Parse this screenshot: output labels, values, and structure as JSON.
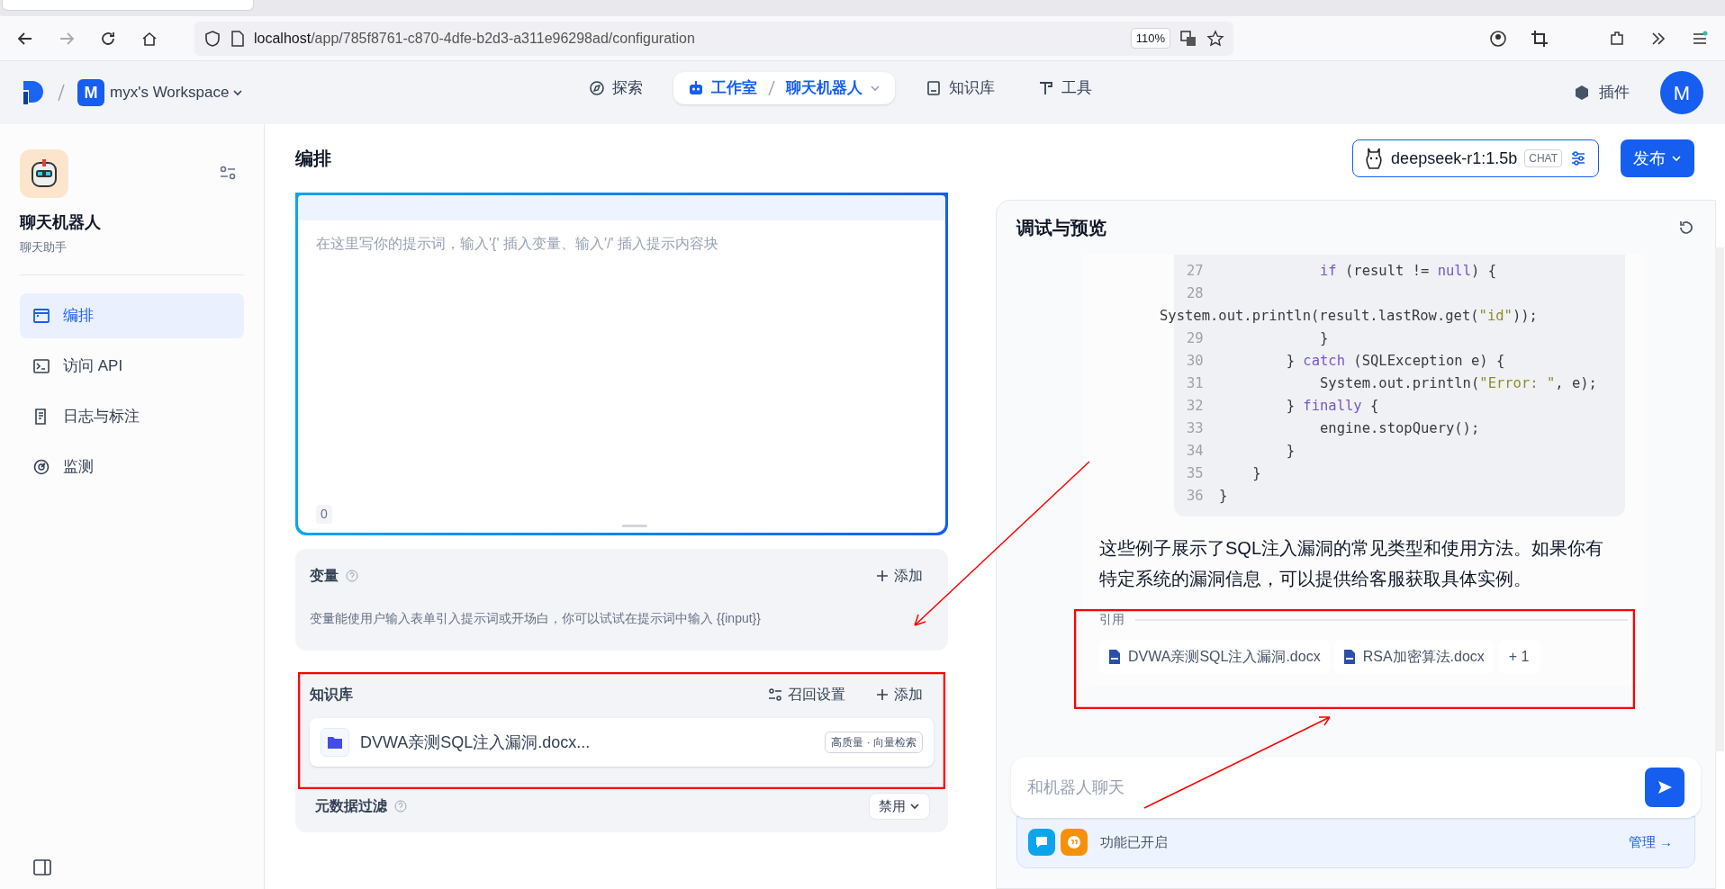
{
  "browser": {
    "url_host": "localhost",
    "url_path": "/app/785f8761-c870-4dfe-b2d3-a311e96298ad/configuration",
    "zoom": "110%"
  },
  "header": {
    "workspace_initial": "M",
    "workspace": "myx's Workspace",
    "nav": [
      {
        "label": "探索",
        "selected": false
      },
      {
        "label": "工作室",
        "selected": true,
        "sub": "聊天机器人"
      },
      {
        "label": "知识库",
        "selected": false
      },
      {
        "label": "工具",
        "selected": false
      }
    ],
    "plugins": "插件",
    "user_initial": "M"
  },
  "sidebar": {
    "app_name": "聊天机器人",
    "app_type": "聊天助手",
    "items": [
      {
        "label": "编排",
        "selected": true
      },
      {
        "label": "访问 API",
        "selected": false
      },
      {
        "label": "日志与标注",
        "selected": false
      },
      {
        "label": "监测",
        "selected": false
      }
    ]
  },
  "page": {
    "title": "编排",
    "model": "deepseek-r1:1.5b",
    "model_mode": "CHAT",
    "publish": "发布"
  },
  "prompt": {
    "placeholder": "在这里写你的提示词，输入'{' 插入变量、输入'/' 插入提示内容块",
    "count": "0"
  },
  "variables": {
    "title": "变量",
    "add": "添加",
    "description": "变量能使用户输入表单引入提示词或开场白，你可以试试在提示词中输入 {{input}}"
  },
  "knowledge": {
    "title": "知识库",
    "retrieval_settings": "召回设置",
    "add": "添加",
    "items": [
      {
        "name": "DVWA亲测SQL注入漏洞.docx...",
        "tag": "高质量 · 向量检索"
      }
    ],
    "metadata_filter": {
      "label": "元数据过滤",
      "value": "禁用"
    }
  },
  "preview": {
    "title": "调试与预览",
    "code_lines": [
      {
        "num": "27",
        "wrap": false,
        "tokens": [
          {
            "kind": "keyword",
            "text": "            if"
          },
          {
            "kind": "plain",
            "text": " (result != "
          },
          {
            "kind": "keyword",
            "text": "null"
          },
          {
            "kind": "plain",
            "text": ") {"
          }
        ]
      },
      {
        "num": "28",
        "wrap": true,
        "tokens": [
          {
            "kind": "plain",
            "text": "System.out.println(result.lastRow.get("
          },
          {
            "kind": "string",
            "text": "\"id\""
          },
          {
            "kind": "plain",
            "text": "));"
          }
        ]
      },
      {
        "num": "29",
        "wrap": false,
        "tokens": [
          {
            "kind": "plain",
            "text": "            }"
          }
        ]
      },
      {
        "num": "30",
        "wrap": false,
        "tokens": [
          {
            "kind": "plain",
            "text": "        } "
          },
          {
            "kind": "keyword",
            "text": "catch"
          },
          {
            "kind": "plain",
            "text": " (SQLException e) {"
          }
        ]
      },
      {
        "num": "31",
        "wrap": false,
        "tokens": [
          {
            "kind": "plain",
            "text": "            System.out.println("
          },
          {
            "kind": "string",
            "text": "\"Error: \""
          },
          {
            "kind": "plain",
            "text": ", e);"
          }
        ]
      },
      {
        "num": "32",
        "wrap": false,
        "tokens": [
          {
            "kind": "plain",
            "text": "        } "
          },
          {
            "kind": "keyword",
            "text": "finally"
          },
          {
            "kind": "plain",
            "text": " {"
          }
        ]
      },
      {
        "num": "33",
        "wrap": false,
        "tokens": [
          {
            "kind": "plain",
            "text": "            engine.stopQuery();"
          }
        ]
      },
      {
        "num": "34",
        "wrap": false,
        "tokens": [
          {
            "kind": "plain",
            "text": "        }"
          }
        ]
      },
      {
        "num": "35",
        "wrap": false,
        "tokens": [
          {
            "kind": "plain",
            "text": "    }"
          }
        ]
      },
      {
        "num": "36",
        "wrap": false,
        "tokens": [
          {
            "kind": "plain",
            "text": "}"
          }
        ]
      }
    ],
    "answer": "这些例子展示了SQL注入漏洞的常见类型和使用方法。如果你有特定系统的漏洞信息，可以提供给客服获取具体实例。",
    "citations_label": "引用",
    "citations": [
      "DVWA亲测SQL注入漏洞.docx",
      "RSA加密算法.docx"
    ],
    "citations_more": "+ 1",
    "input_placeholder": "和机器人聊天",
    "features": "功能已开启",
    "manage": "管理 →"
  }
}
